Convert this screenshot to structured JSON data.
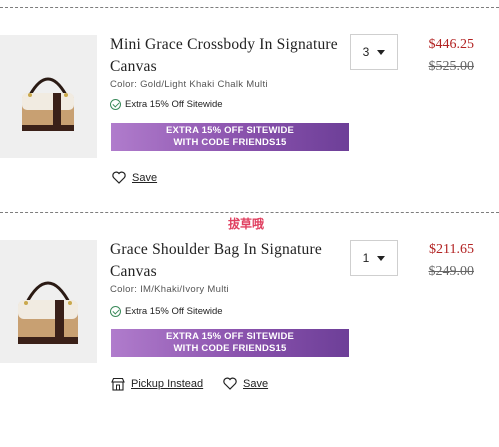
{
  "items": [
    {
      "name": "Mini Grace Crossbody In Signature Canvas",
      "color": "Color: Gold/Light Khaki Chalk Multi",
      "extra": "Extra 15% Off Sitewide",
      "banner_line1": "EXTRA 15% OFF SITEWIDE",
      "banner_line2": "WITH CODE FRIENDS15",
      "qty": "3",
      "sale_price": "$446.25",
      "orig_price": "$525.00",
      "save_label": "Save"
    },
    {
      "name": "Grace Shoulder Bag In Signature Canvas",
      "color": "Color: IM/Khaki/Ivory Multi",
      "extra": "Extra 15% Off Sitewide",
      "banner_line1": "EXTRA 15% OFF SITEWIDE",
      "banner_line2": "WITH CODE FRIENDS15",
      "qty": "1",
      "sale_price": "$211.65",
      "orig_price": "$249.00",
      "pickup_label": "Pickup Instead",
      "save_label": "Save"
    }
  ],
  "watermark": "拔草哦",
  "colors": {
    "sale": "#b22222",
    "banner_start": "#b07ccc",
    "banner_end": "#6d3f98",
    "check": "#3a8a5a"
  }
}
